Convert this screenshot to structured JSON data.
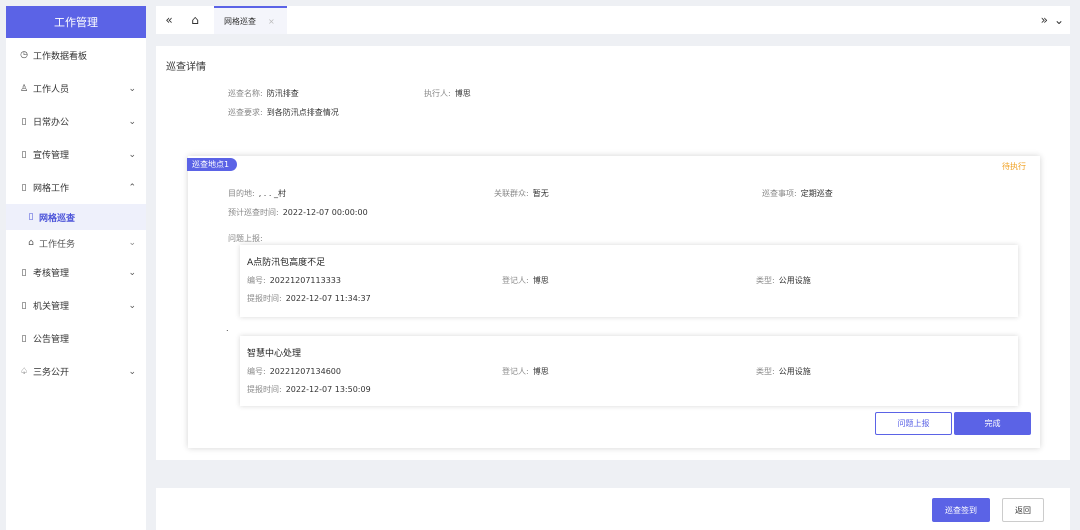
{
  "sidebar": {
    "title": "工作管理",
    "items": [
      {
        "label": "工作数据看板",
        "icon": "palette-icon",
        "glyph": "◷",
        "chevron": ""
      },
      {
        "label": "工作人员",
        "icon": "person-icon",
        "glyph": "♙",
        "chevron": "⌄"
      },
      {
        "label": "日常办公",
        "icon": "document-icon",
        "glyph": "▯",
        "chevron": "⌄"
      },
      {
        "label": "宣传管理",
        "icon": "document-icon",
        "glyph": "▯",
        "chevron": "⌄"
      },
      {
        "label": "网格工作",
        "icon": "document-icon",
        "glyph": "▯",
        "chevron": "⌃"
      }
    ],
    "subitems": [
      {
        "label": "网格巡查",
        "glyph": "▯"
      },
      {
        "label": "工作任务",
        "glyph": "⌂",
        "chevron": "⌄"
      }
    ],
    "items2": [
      {
        "label": "考核管理",
        "glyph": "▯",
        "chevron": "⌄"
      },
      {
        "label": "机关管理",
        "glyph": "▯",
        "chevron": "⌄"
      },
      {
        "label": "公告管理",
        "glyph": "▯",
        "chevron": ""
      },
      {
        "label": "三务公开",
        "glyph": "♤",
        "chevron": "⌄"
      }
    ]
  },
  "topbar": {
    "collapse_glyph": "«",
    "home_glyph": "⌂",
    "tab_label": "网格巡查",
    "tab_close": "×",
    "more_glyph": "»",
    "dropdown_glyph": "⌄"
  },
  "main": {
    "title": "巡查详情",
    "name_label": "巡查名称:",
    "name_value": "防汛排查",
    "executor_label": "执行人:",
    "executor_value": "博思",
    "requirement_label": "巡查要求:",
    "requirement_value": "到各防汛点排查情况"
  },
  "location": {
    "tag": "巡查地点1",
    "status": "待执行",
    "dest_label": "目的地:",
    "dest_value": ", . .  _村",
    "group_label": "关联群众:",
    "group_value": "暂无",
    "matter_label": "巡查事项:",
    "matter_value": "定期巡查",
    "time_label": "预计巡查时间:",
    "time_value": "2022-12-07 00:00:00",
    "issues_label": "问题上报:",
    "dot": "."
  },
  "reports": [
    {
      "title": "A点防汛包高度不足",
      "no_label": "编号:",
      "no_value": "20221207113333",
      "reg_label": "登记人:",
      "reg_value": "博思",
      "type_label": "类型:",
      "type_value": "公用设施",
      "time_label": "提报时间:",
      "time_value": "2022-12-07 11:34:37"
    },
    {
      "title": "智慧中心处理",
      "no_label": "编号:",
      "no_value": "20221207134600",
      "reg_label": "登记人:",
      "reg_value": "博思",
      "type_label": "类型:",
      "type_value": "公用设施",
      "time_label": "提报时间:",
      "time_value": "2022-12-07 13:50:09"
    }
  ],
  "buttons": {
    "report": "问题上报",
    "complete": "完成",
    "sign": "巡查签到",
    "back": "返回"
  },
  "colors": {
    "accent": "#5b63e6",
    "status": "#f0a020"
  }
}
